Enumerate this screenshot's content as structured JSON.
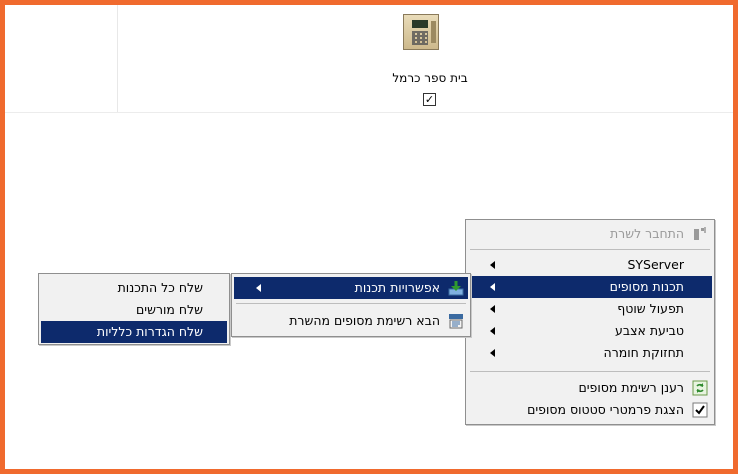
{
  "terminal": {
    "name": "בית ספר כרמל",
    "checked": "✓"
  },
  "main_menu": {
    "items": [
      {
        "label": "התחבר לשרת",
        "state": "disabled",
        "icon": "connect-icon"
      },
      {
        "label": "SYServer",
        "submenu": true
      },
      {
        "label": "תכנות מסופים",
        "submenu": true,
        "state": "selected"
      },
      {
        "label": "תפעול שוטף",
        "submenu": true
      },
      {
        "label": "טביעת אצבע",
        "submenu": true
      },
      {
        "label": "תחזוקת חומרה",
        "submenu": true
      },
      {
        "label": "רענן רשימת מסופים",
        "icon": "refresh-icon"
      },
      {
        "label": "הצגת פרמטרי סטטוס מסופים",
        "icon": "check-icon"
      }
    ]
  },
  "programming_menu": {
    "items": [
      {
        "label": "אפשרויות תכנות",
        "submenu": true,
        "state": "selected",
        "icon": "download-icon"
      },
      {
        "label": "הבא רשימת מסופים מהשרת",
        "icon": "server-list-icon"
      }
    ]
  },
  "options_menu": {
    "items": [
      {
        "label": "שלח כל התכנות"
      },
      {
        "label": "שלח מורשים"
      },
      {
        "label": "שלח הגדרות כלליות",
        "state": "selected"
      }
    ]
  },
  "colors": {
    "frame": "#f06a2e",
    "selection": "#0d2a6c",
    "menu_bg": "#f1f1f1"
  }
}
